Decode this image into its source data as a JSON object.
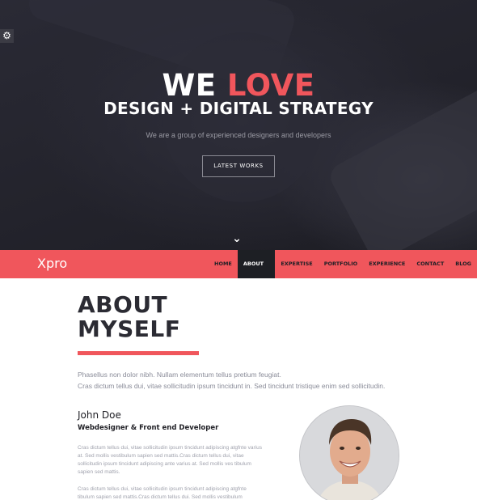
{
  "hero": {
    "title_part1": "WE ",
    "title_part2": "LOVE",
    "subtitle": "DESIGN + DIGITAL STRATEGY",
    "tagline": "We are a group of experienced designers and developers",
    "button_label": "LATEST WORKS",
    "settings_icon": "gear-icon",
    "scroll_icon": "chevron-down-icon",
    "gear_glyph": "⚙",
    "chevron_glyph": "⌄"
  },
  "nav": {
    "logo": "Xpro",
    "items": [
      {
        "label": "HOME",
        "active": false
      },
      {
        "label": "ABOUT ME",
        "active": true
      },
      {
        "label": "EXPERTISE",
        "active": false
      },
      {
        "label": "PORTFOLIO",
        "active": false
      },
      {
        "label": "EXPERIENCE",
        "active": false
      },
      {
        "label": "CONTACT",
        "active": false
      },
      {
        "label": "BLOG",
        "active": false
      }
    ]
  },
  "about": {
    "title_line1": "ABOUT",
    "title_line2": "MYSELF",
    "intro_line1": "Phasellus non dolor nibh. Nullam elementum tellus pretium feugiat.",
    "intro_line2": "Cras dictum tellus dui, vitae sollicitudin ipsum tincidunt in. Sed tincidunt tristique enim sed sollicitudin.",
    "name": "John Doe",
    "role": "Webdesigner & Front end Developer",
    "paragraph1": "Cras dictum tellus dui, vitae sollicitudin ipsum tincidunt adipiscing atgfnte varius at. Sed mollis vestibulum sapien sed mattis.Cras dictum tellus dui, vitae sollicitudin ipsum tincidunt adipiscing ante varius at. Sed mollis ves tibulum sapien sed mattis.",
    "paragraph2": "Cras dictum tellus dui, vitae sollicitudin ipsum tincidunt adipiscing atgfnte tibulum sapien sed mattis.Cras dictum tellus dui. Sed mollis vestibulum"
  },
  "colors": {
    "accent": "#f0565c",
    "dark": "#1d1f24",
    "hero_bg": "#26262f"
  }
}
